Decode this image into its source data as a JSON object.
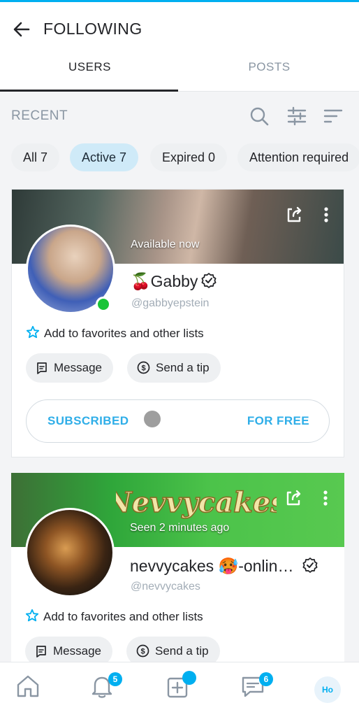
{
  "header": {
    "title": "FOLLOWING",
    "back_icon": "arrow-left-icon"
  },
  "tabs": [
    {
      "label": "USERS",
      "active": true
    },
    {
      "label": "POSTS",
      "active": false
    }
  ],
  "section": {
    "label": "RECENT"
  },
  "filters": [
    {
      "label": "All 7",
      "active": false
    },
    {
      "label": "Active 7",
      "active": true
    },
    {
      "label": "Expired 0",
      "active": false
    },
    {
      "label": "Attention required",
      "active": false
    }
  ],
  "cards": [
    {
      "status": "Available now",
      "name": "🍒Gabby",
      "handle": "@gabbyepstein",
      "favorites": "Add to favorites and other lists",
      "message": "Message",
      "tip": "Send a tip",
      "subscribed": "SUBSCRIBED",
      "price": "FOR FREE",
      "online": true
    },
    {
      "status": "Seen 2 minutes ago",
      "banner_text": "Nevvycakes",
      "name": "nevvycakes 🥵-onlin…",
      "handle": "@nevvycakes",
      "favorites": "Add to favorites and other lists",
      "message": "Message",
      "tip": "Send a tip"
    }
  ],
  "bottom_nav": {
    "notifications_badge": "5",
    "messages_badge": "6",
    "profile_initials": "Ho"
  },
  "colors": {
    "accent": "#00aff0",
    "text": "#242529",
    "muted": "#8a96a3"
  }
}
